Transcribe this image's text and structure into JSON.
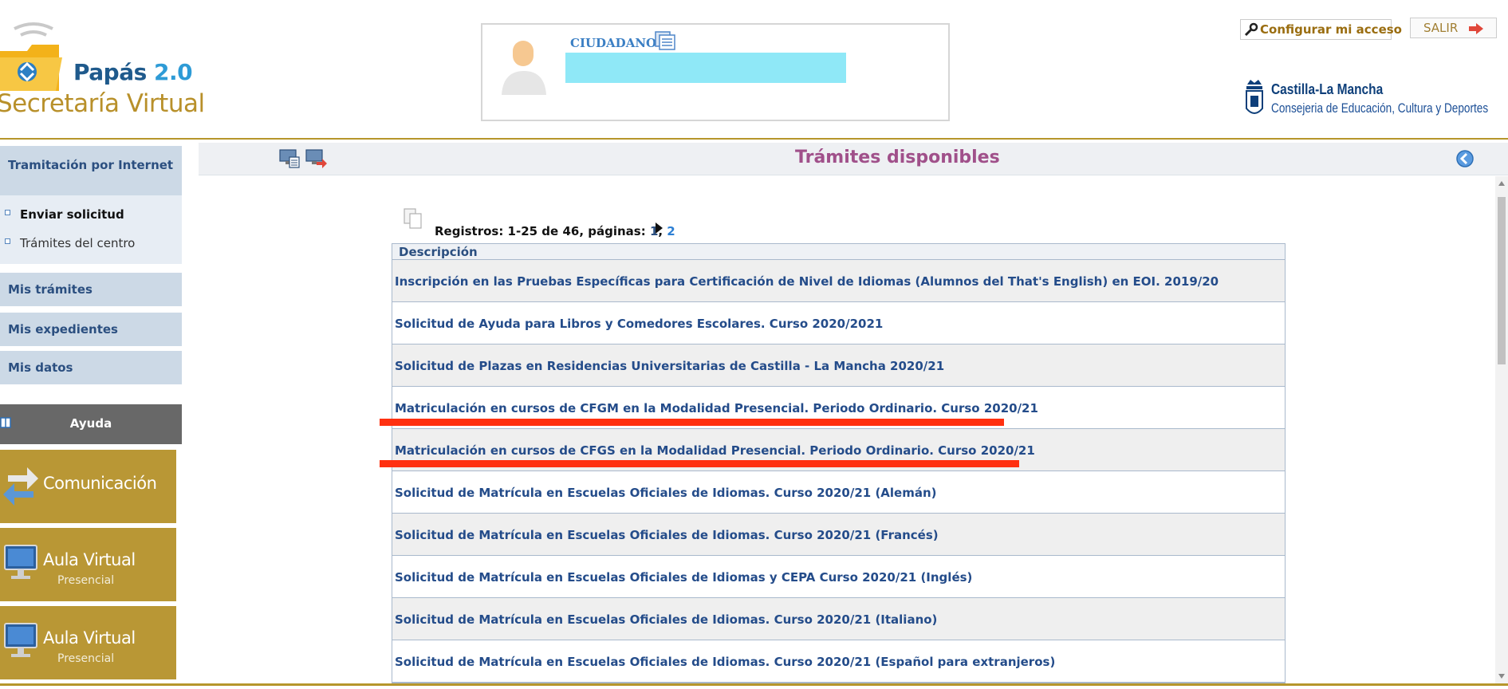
{
  "header": {
    "logo_title_main": "Papás",
    "logo_title_version": "2.0",
    "logo_subtitle": "Secretaría Virtual",
    "user_role": "CIUDADANO",
    "user_name": "",
    "config_label": "Configurar mi acceso",
    "exit_label": "SALIR",
    "org_name": "Castilla-La Mancha",
    "org_department": "Consejeria de Educación, Cultura y Deportes"
  },
  "sidebar": {
    "section_tramitacion": "Tramitación por Internet",
    "item_enviar": "Enviar solicitud",
    "item_tramites_centro": "Trámites del centro",
    "item_mis_tramites": "Mis trámites",
    "item_mis_expedientes": "Mis expedientes",
    "item_mis_datos": "Mis datos",
    "help_label": "Ayuda",
    "banner_comunicacion": "Comunicación",
    "banner_aula_title": "Aula Virtual",
    "banner_aula_sub": "Presencial"
  },
  "main": {
    "title": "Trámites disponibles",
    "records_prefix": "Registros: 1-25 de 46, páginas: ",
    "page1": "1",
    "page_sep": ", ",
    "page2": "2",
    "table_header": "Descripción",
    "rows": [
      "Inscripción en las Pruebas Específicas para Certificación de Nivel de Idiomas (Alumnos del That's English) en EOI. 2019/20",
      "Solicitud de Ayuda para Libros y Comedores Escolares. Curso 2020/2021",
      "Solicitud de Plazas en Residencias Universitarias de Castilla - La Mancha 2020/21",
      "Matriculación en cursos de CFGM en la Modalidad Presencial. Periodo Ordinario. Curso 2020/21",
      "Matriculación en cursos de CFGS en la Modalidad Presencial. Periodo Ordinario. Curso 2020/21",
      "Solicitud de Matrícula en Escuelas Oficiales de Idiomas. Curso 2020/21 (Alemán)",
      "Solicitud de Matrícula en Escuelas Oficiales de Idiomas. Curso 2020/21 (Francés)",
      "Solicitud de Matrícula en Escuelas Oficiales de Idiomas y CEPA Curso 2020/21 (Inglés)",
      "Solicitud de Matrícula en Escuelas Oficiales de Idiomas. Curso 2020/21 (Italiano)",
      "Solicitud de Matrícula en Escuelas Oficiales de Idiomas. Curso 2020/21 (Español para extranjeros)"
    ]
  },
  "icons": {
    "user_list": "list-icon",
    "config": "wrench-icon",
    "exit": "arrow-right-icon",
    "back": "back-circle-icon",
    "copy": "copy-icon",
    "help": "book-icon"
  },
  "colors": {
    "gold": "#b6962b",
    "nav_blue": "#ccd9e6",
    "title_purple": "#a0508a",
    "link_blue": "#244c8a",
    "highlight_red": "#ff3010",
    "redacted": "#8fe8f7"
  }
}
